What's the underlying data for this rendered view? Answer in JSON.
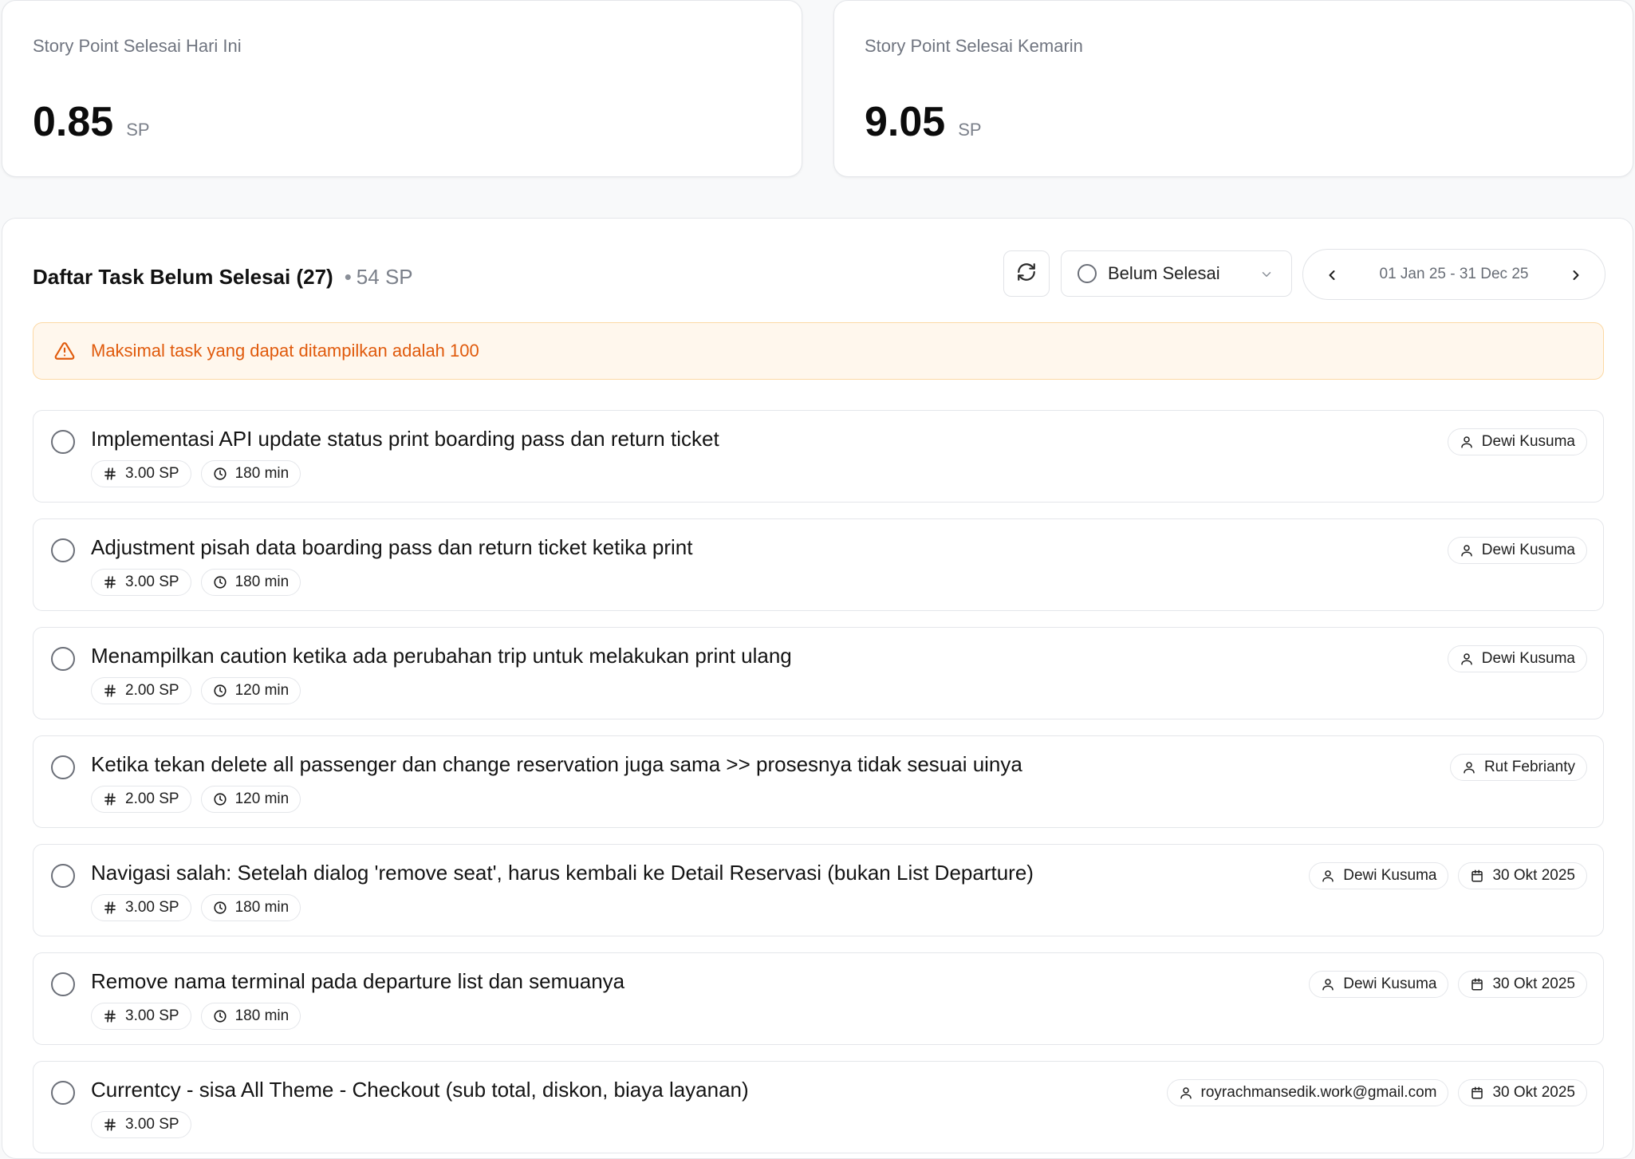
{
  "stats": {
    "today": {
      "label": "Story Point Selesai Hari Ini",
      "value": "0.85",
      "unit": "SP"
    },
    "yesterday": {
      "label": "Story Point Selesai Kemarin",
      "value": "9.05",
      "unit": "SP"
    }
  },
  "panel": {
    "title": "Daftar Task Belum Selesai (27)",
    "separator": "•",
    "total_sp": "54 SP",
    "status_filter": "Belum Selesai",
    "date_range": "01 Jan 25 - 31 Dec 25",
    "alert": "Maksimal task yang dapat ditampilkan adalah 100"
  },
  "icons": {
    "refresh": "refresh-icon",
    "chevron": "chevron-down-icon",
    "warning": "warning-triangle-icon",
    "hash": "hash-icon",
    "clock": "clock-icon",
    "user": "user-icon",
    "calendar": "calendar-icon"
  },
  "colors": {
    "accent_warning": "#e05a0c",
    "alert_bg": "#fff7ed",
    "alert_border": "#fcd9a5"
  },
  "tasks": [
    {
      "title": "Implementasi API update status print boarding pass dan return ticket",
      "sp": "3.00 SP",
      "duration": "180 min",
      "assignee": "Dewi Kusuma",
      "date": null
    },
    {
      "title": "Adjustment pisah data boarding pass dan return ticket ketika print",
      "sp": "3.00 SP",
      "duration": "180 min",
      "assignee": "Dewi Kusuma",
      "date": null
    },
    {
      "title": "Menampilkan caution ketika ada perubahan trip untuk melakukan print ulang",
      "sp": "2.00 SP",
      "duration": "120 min",
      "assignee": "Dewi Kusuma",
      "date": null
    },
    {
      "title": "Ketika tekan delete all passenger dan change reservation juga sama >> prosesnya tidak sesuai uinya",
      "sp": "2.00 SP",
      "duration": "120 min",
      "assignee": "Rut Febrianty",
      "date": null
    },
    {
      "title": "Navigasi salah: Setelah dialog 'remove seat', harus kembali ke Detail Reservasi (bukan List Departure)",
      "sp": "3.00 SP",
      "duration": "180 min",
      "assignee": "Dewi Kusuma",
      "date": "30 Okt 2025"
    },
    {
      "title": "Remove nama terminal pada departure list dan semuanya",
      "sp": "3.00 SP",
      "duration": "180 min",
      "assignee": "Dewi Kusuma",
      "date": "30 Okt 2025"
    },
    {
      "title": "Currentcy - sisa All Theme - Checkout (sub total, diskon, biaya layanan)",
      "sp": "3.00 SP",
      "duration": null,
      "assignee": "royrachmansedik.work@gmail.com",
      "date": "30 Okt 2025"
    }
  ]
}
